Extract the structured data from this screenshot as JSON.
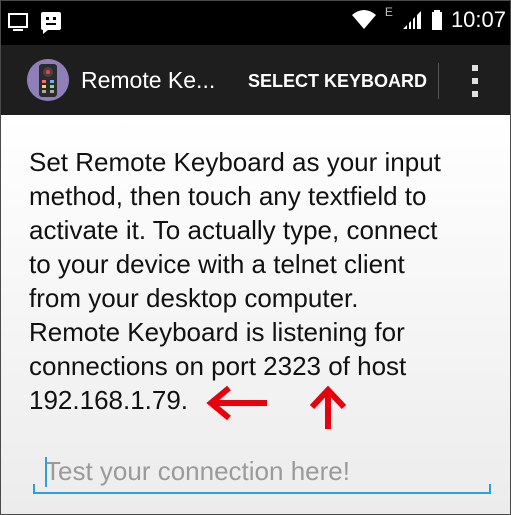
{
  "status_bar": {
    "time": "10:07",
    "network_letter": "E",
    "icons": [
      "screen-icon",
      "notification-face-icon",
      "wifi-icon",
      "signal-icon",
      "battery-icon"
    ]
  },
  "action_bar": {
    "app_title": "Remote Ke...",
    "select_keyboard_label": "SELECT KEYBOARD",
    "icons": [
      "remote-control-app-icon",
      "overflow-menu-icon"
    ]
  },
  "main": {
    "message": "Set Remote Keyboard as your input\nmethod, then touch any textfield to\nactivate it. To actually type, connect\nto your device with a telnet client\nfrom your desktop computer.\nRemote Keyboard is listening for\nconnections on port 2323 of host\n192.168.1.79.",
    "test_input_placeholder": "Test your connection here!",
    "test_input_value": ""
  },
  "annotations": {
    "arrow_color": "#e8000d",
    "arrows": [
      "left-arrow",
      "up-arrow"
    ]
  },
  "colors": {
    "status_bar": "#000000",
    "action_bar": "#1e1e1e",
    "input_accent": "#2e9fd8"
  }
}
